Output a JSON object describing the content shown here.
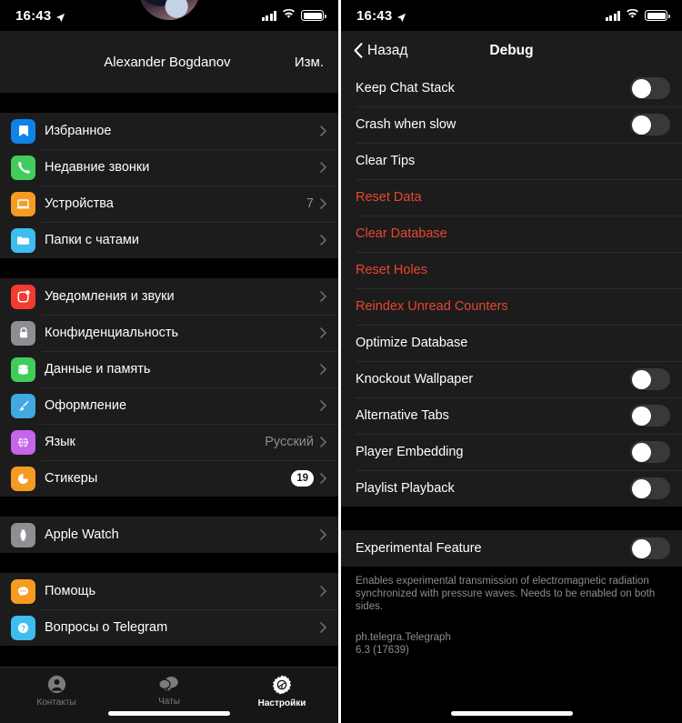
{
  "status_bar": {
    "time": "16:43",
    "location_icon": "location-arrow-icon",
    "wifi_icon": "wifi-icon",
    "battery_icon": "battery-icon",
    "signal_icon": "cellular-signal-icon"
  },
  "left_panel": {
    "profile": {
      "name": "Alexander Bogdanov",
      "edit_label": "Изм.",
      "avatar": "user-avatar"
    },
    "sections": [
      {
        "items": [
          {
            "label": "Избранное",
            "icon": "bookmark-icon",
            "icon_color": "#0f83e8",
            "value": "",
            "chevron": true
          },
          {
            "label": "Недавние звонки",
            "icon": "phone-icon",
            "icon_color": "#42cc5c",
            "value": "",
            "chevron": true
          },
          {
            "label": "Устройства",
            "icon": "laptop-icon",
            "icon_color": "#f59b22",
            "value": "7",
            "chevron": true
          },
          {
            "label": "Папки с чатами",
            "icon": "folder-icon",
            "icon_color": "#3dbdf0",
            "value": "",
            "chevron": true
          }
        ]
      },
      {
        "items": [
          {
            "label": "Уведомления и звуки",
            "icon": "notifications-icon",
            "icon_color": "#f33b30",
            "value": "",
            "chevron": true
          },
          {
            "label": "Конфиденциальность",
            "icon": "lock-icon",
            "icon_color": "#8e8e93",
            "value": "",
            "chevron": true
          },
          {
            "label": "Данные и память",
            "icon": "database-icon",
            "icon_color": "#42cc5c",
            "value": "",
            "chevron": true
          },
          {
            "label": "Оформление",
            "icon": "brush-icon",
            "icon_color": "#41a8e0",
            "value": "",
            "chevron": true
          },
          {
            "label": "Язык",
            "icon": "globe-icon",
            "icon_color": "#c565e8",
            "value": "Русский",
            "chevron": true
          },
          {
            "label": "Стикеры",
            "icon": "sticker-icon",
            "icon_color": "#f59b22",
            "badge": "19",
            "chevron": true
          }
        ]
      },
      {
        "items": [
          {
            "label": "Apple Watch",
            "icon": "watch-icon",
            "icon_color": "#8e8e93",
            "value": "",
            "chevron": true
          }
        ]
      },
      {
        "items": [
          {
            "label": "Помощь",
            "icon": "chat-help-icon",
            "icon_color": "#f59b22",
            "value": "",
            "chevron": true
          },
          {
            "label": "Вопросы о Telegram",
            "icon": "question-icon",
            "icon_color": "#3dbdf0",
            "value": "",
            "chevron": true
          }
        ]
      }
    ],
    "tabs": [
      {
        "label": "Контакты",
        "icon": "contacts-icon",
        "active": false
      },
      {
        "label": "Чаты",
        "icon": "chats-icon",
        "active": false
      },
      {
        "label": "Настройки",
        "icon": "settings-gear-icon",
        "active": true
      }
    ]
  },
  "right_panel": {
    "nav": {
      "back_label": "Назад",
      "title": "Debug",
      "back_icon": "chevron-left-icon"
    },
    "sections": [
      {
        "items": [
          {
            "label": "Keep Chat Stack",
            "type": "switch",
            "on": false,
            "danger": false
          },
          {
            "label": "Crash when slow",
            "type": "switch",
            "on": false,
            "danger": false
          },
          {
            "label": "Clear Tips",
            "type": "action",
            "danger": false
          },
          {
            "label": "Reset Data",
            "type": "action",
            "danger": true
          },
          {
            "label": "Clear Database",
            "type": "action",
            "danger": true
          },
          {
            "label": "Reset Holes",
            "type": "action",
            "danger": true
          },
          {
            "label": "Reindex Unread Counters",
            "type": "action",
            "danger": true
          },
          {
            "label": "Optimize Database",
            "type": "action",
            "danger": false
          },
          {
            "label": "Knockout Wallpaper",
            "type": "switch",
            "on": false,
            "danger": false
          },
          {
            "label": "Alternative Tabs",
            "type": "switch",
            "on": false,
            "danger": false
          },
          {
            "label": "Player Embedding",
            "type": "switch",
            "on": false,
            "danger": false
          },
          {
            "label": "Playlist Playback",
            "type": "switch",
            "on": false,
            "danger": false
          }
        ]
      },
      {
        "items": [
          {
            "label": "Experimental Feature",
            "type": "switch",
            "on": false,
            "danger": false
          }
        ]
      }
    ],
    "footnote": "Enables experimental transmission of electromagnetic radiation synchronized with pressure waves. Needs to be enabled on both sides.",
    "bundle_id": "ph.telegra.Telegraph",
    "version": "6.3 (17639)"
  },
  "colors": {
    "background": "#000000",
    "cell": "#1c1c1d",
    "separator": "#2c2c2e",
    "danger": "#e8462e",
    "secondary_text": "#8d8d93",
    "switch_off": "#39393c",
    "switch_on": "#34c759"
  }
}
